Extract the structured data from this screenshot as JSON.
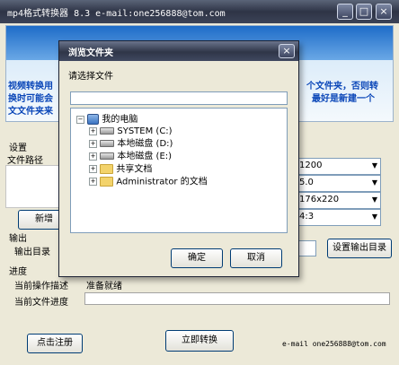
{
  "window": {
    "title": "mp4格式转换器 8.3   e-mail:one256888@tom.com",
    "controls": [
      "_",
      "□",
      "×"
    ]
  },
  "banner": {
    "line1_left": "视频转换用",
    "line2_left": "换时可能会",
    "line3_left": "文文件夹来",
    "line1_right": "个文件夹，否则转",
    "line2_right": "最好是新建一个"
  },
  "settings": {
    "group_label": "设置",
    "file_path_label": "文件路径",
    "add_button": "新增",
    "combos": [
      "1200",
      "5.0",
      "176x220",
      "4:3"
    ]
  },
  "output": {
    "group_label": "输出",
    "dir_label": "输出目录",
    "dir_value": "",
    "set_button": "设置输出目录"
  },
  "progress": {
    "group_label": "进度",
    "op_label": "当前操作描述",
    "op_value": "准备就绪",
    "file_label": "当前文件进度",
    "value": 0
  },
  "footer": {
    "register_button": "点击注册",
    "convert_button": "立即转换",
    "email": "e-mail one256888@tom.com"
  },
  "dialog": {
    "title": "浏览文件夹",
    "prompt": "请选择文件",
    "path_value": "",
    "tree": [
      {
        "label": "我的电脑",
        "icon": "computer-icon",
        "level": 0,
        "toggle": "−"
      },
      {
        "label": "SYSTEM (C:)",
        "icon": "drive-icon",
        "level": 1,
        "toggle": "+"
      },
      {
        "label": "本地磁盘 (D:)",
        "icon": "drive-icon",
        "level": 1,
        "toggle": "+"
      },
      {
        "label": "本地磁盘 (E:)",
        "icon": "drive-icon",
        "level": 1,
        "toggle": "+"
      },
      {
        "label": "共享文档",
        "icon": "folder-icon",
        "level": 1,
        "toggle": "+"
      },
      {
        "label": "Administrator 的文档",
        "icon": "folder-icon",
        "level": 1,
        "toggle": "+"
      }
    ],
    "ok_button": "确定",
    "cancel_button": "取消",
    "close": "×"
  }
}
